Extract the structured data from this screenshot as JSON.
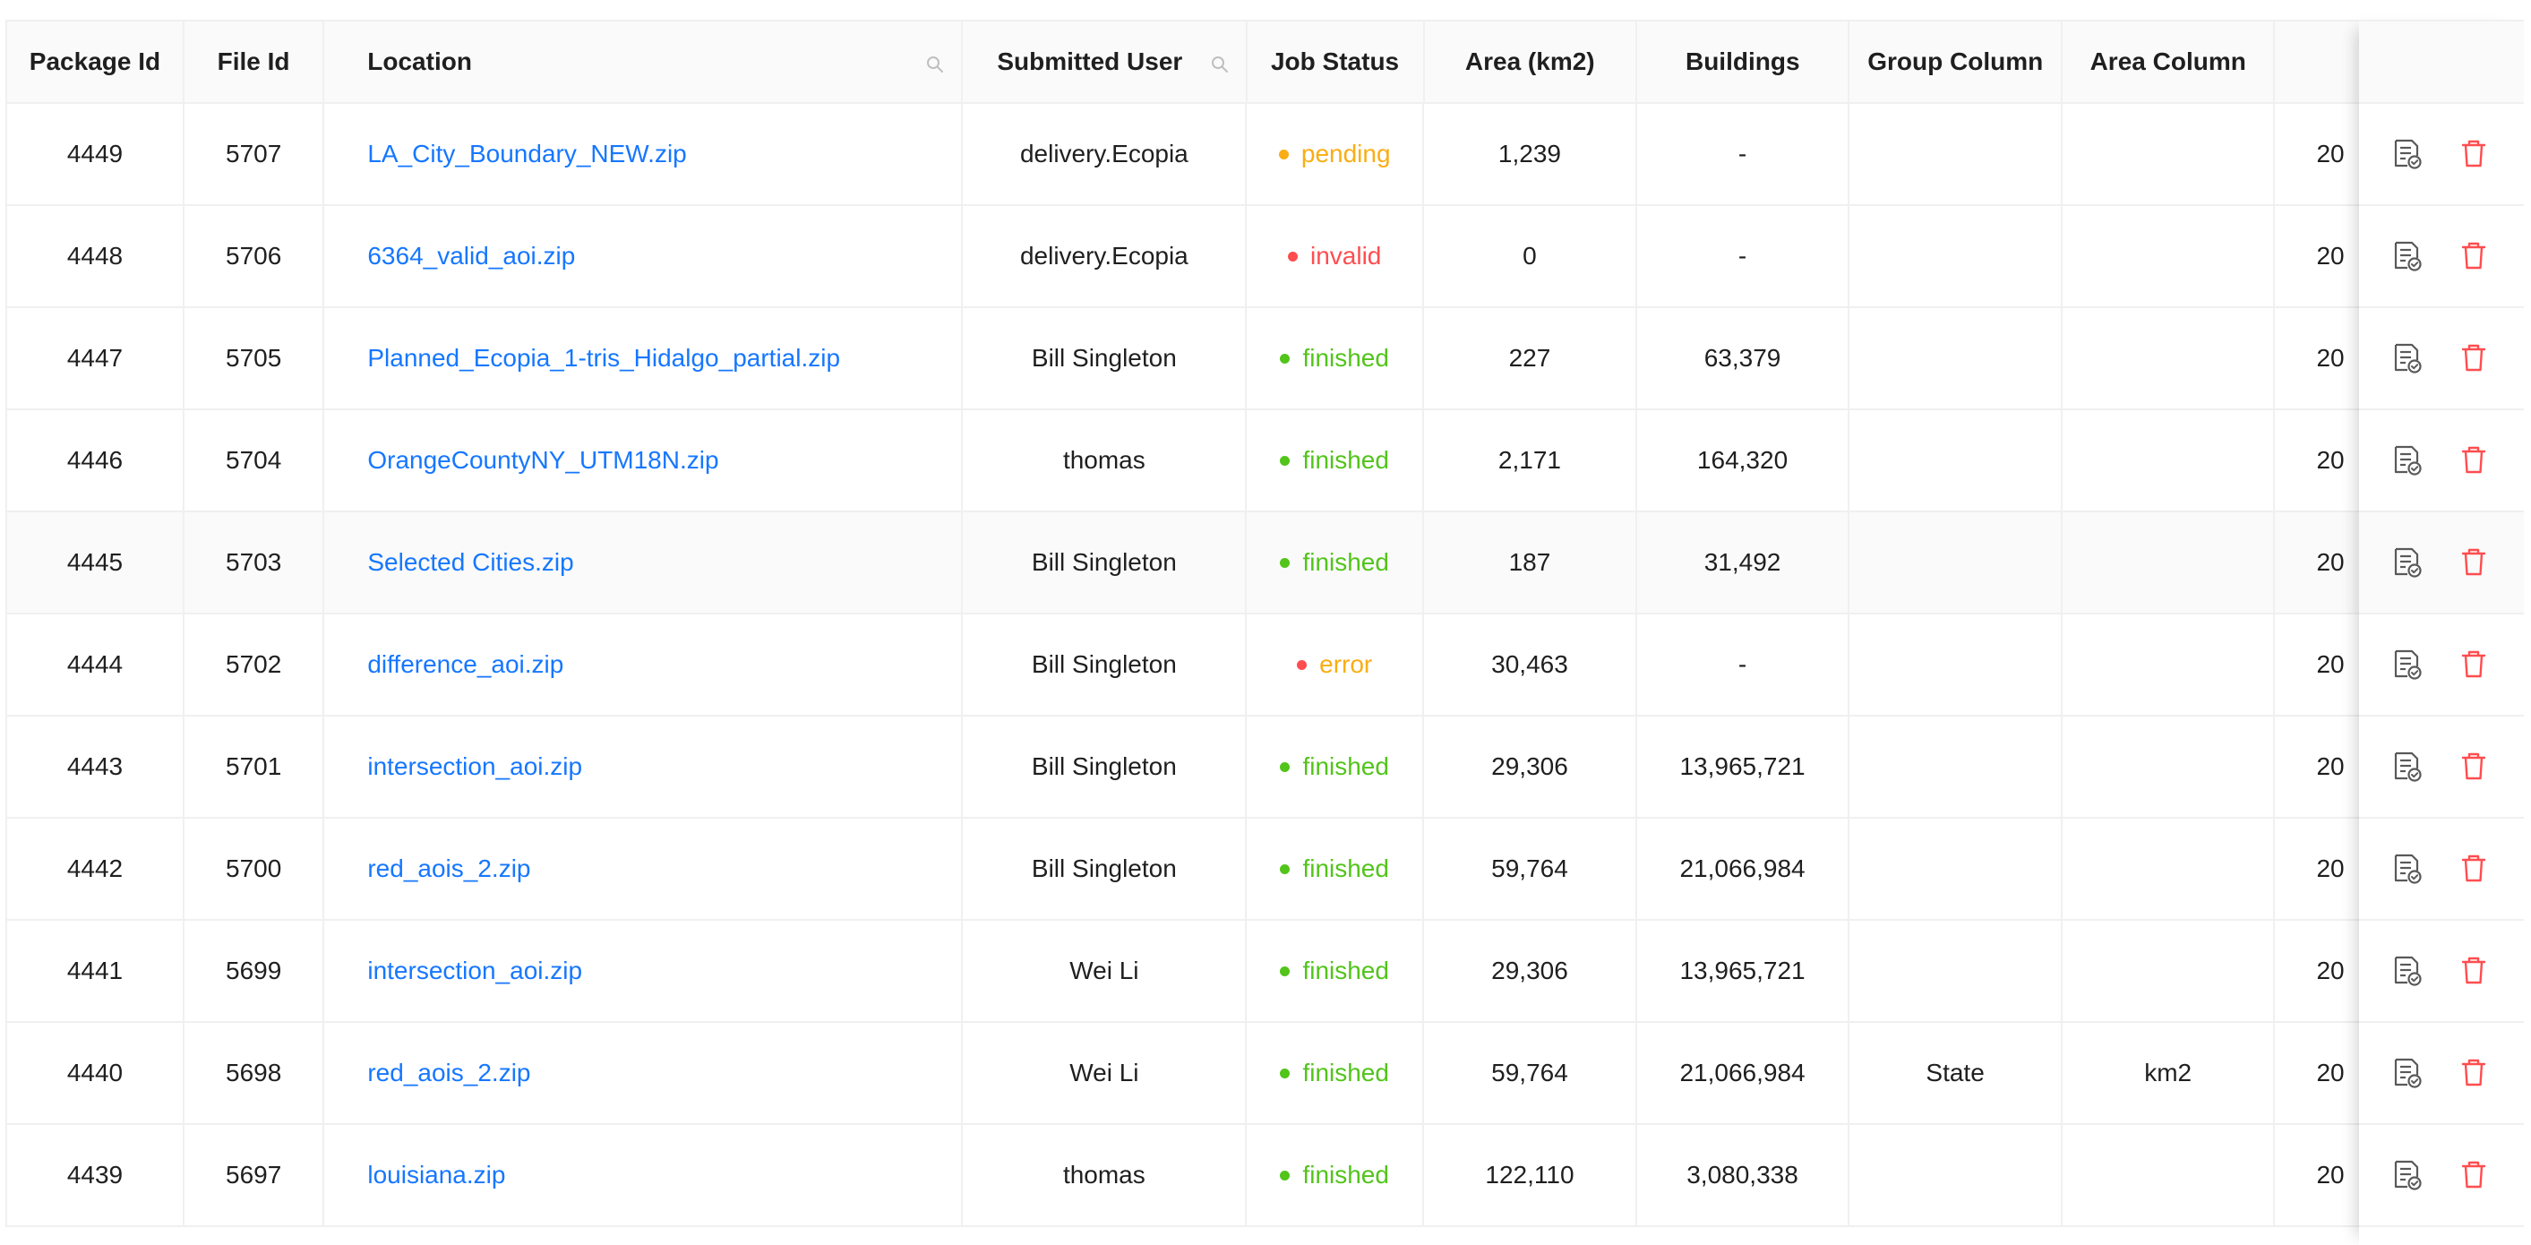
{
  "table": {
    "columns": {
      "package_id": "Package Id",
      "file_id": "File Id",
      "location": "Location",
      "submitted_user": "Submitted User",
      "job_status": "Job Status",
      "area": "Area (km2)",
      "buildings": "Buildings",
      "group_column": "Group Column",
      "area_column": "Area Column"
    },
    "rows": [
      {
        "package_id": "4449",
        "file_id": "5707",
        "location": "LA_City_Boundary_NEW.zip",
        "user": "delivery.Ecopia",
        "status": "pending",
        "area": "1,239",
        "buildings": "-",
        "group_column": "",
        "area_column": "",
        "date": "20"
      },
      {
        "package_id": "4448",
        "file_id": "5706",
        "location": "6364_valid_aoi.zip",
        "user": "delivery.Ecopia",
        "status": "invalid",
        "area": "0",
        "buildings": "-",
        "group_column": "",
        "area_column": "",
        "date": "20"
      },
      {
        "package_id": "4447",
        "file_id": "5705",
        "location": "Planned_Ecopia_1-tris_Hidalgo_partial.zip",
        "user": "Bill Singleton",
        "status": "finished",
        "area": "227",
        "buildings": "63,379",
        "group_column": "",
        "area_column": "",
        "date": "20"
      },
      {
        "package_id": "4446",
        "file_id": "5704",
        "location": "OrangeCountyNY_UTM18N.zip",
        "user": "thomas",
        "status": "finished",
        "area": "2,171",
        "buildings": "164,320",
        "group_column": "",
        "area_column": "",
        "date": "20"
      },
      {
        "package_id": "4445",
        "file_id": "5703",
        "location": "Selected Cities.zip",
        "user": "Bill Singleton",
        "status": "finished",
        "area": "187",
        "buildings": "31,492",
        "group_column": "",
        "area_column": "",
        "date": "20"
      },
      {
        "package_id": "4444",
        "file_id": "5702",
        "location": "difference_aoi.zip",
        "user": "Bill Singleton",
        "status": "error",
        "area": "30,463",
        "buildings": "-",
        "group_column": "",
        "area_column": "",
        "date": "20"
      },
      {
        "package_id": "4443",
        "file_id": "5701",
        "location": "intersection_aoi.zip",
        "user": "Bill Singleton",
        "status": "finished",
        "area": "29,306",
        "buildings": "13,965,721",
        "group_column": "",
        "area_column": "",
        "date": "20"
      },
      {
        "package_id": "4442",
        "file_id": "5700",
        "location": "red_aois_2.zip",
        "user": "Bill Singleton",
        "status": "finished",
        "area": "59,764",
        "buildings": "21,066,984",
        "group_column": "",
        "area_column": "",
        "date": "20"
      },
      {
        "package_id": "4441",
        "file_id": "5699",
        "location": "intersection_aoi.zip",
        "user": "Wei Li",
        "status": "finished",
        "area": "29,306",
        "buildings": "13,965,721",
        "group_column": "",
        "area_column": "",
        "date": "20"
      },
      {
        "package_id": "4440",
        "file_id": "5698",
        "location": "red_aois_2.zip",
        "user": "Wei Li",
        "status": "finished",
        "area": "59,764",
        "buildings": "21,066,984",
        "group_column": "State",
        "area_column": "km2",
        "date": "20"
      },
      {
        "package_id": "4439",
        "file_id": "5697",
        "location": "louisiana.zip",
        "user": "thomas",
        "status": "finished",
        "area": "122,110",
        "buildings": "3,080,338",
        "group_column": "",
        "area_column": "",
        "date": "20"
      }
    ]
  },
  "icons": {
    "column_search": "search-icon",
    "view_report": "report-check-icon",
    "delete": "trash-icon"
  },
  "colors": {
    "link": "#1677ff",
    "pending": "#faad14",
    "invalid": "#ff4d4f",
    "error_dot": "#ff4d4f",
    "error_text": "#faad14",
    "finished": "#52c41a",
    "delete": "#ff4d4f"
  }
}
